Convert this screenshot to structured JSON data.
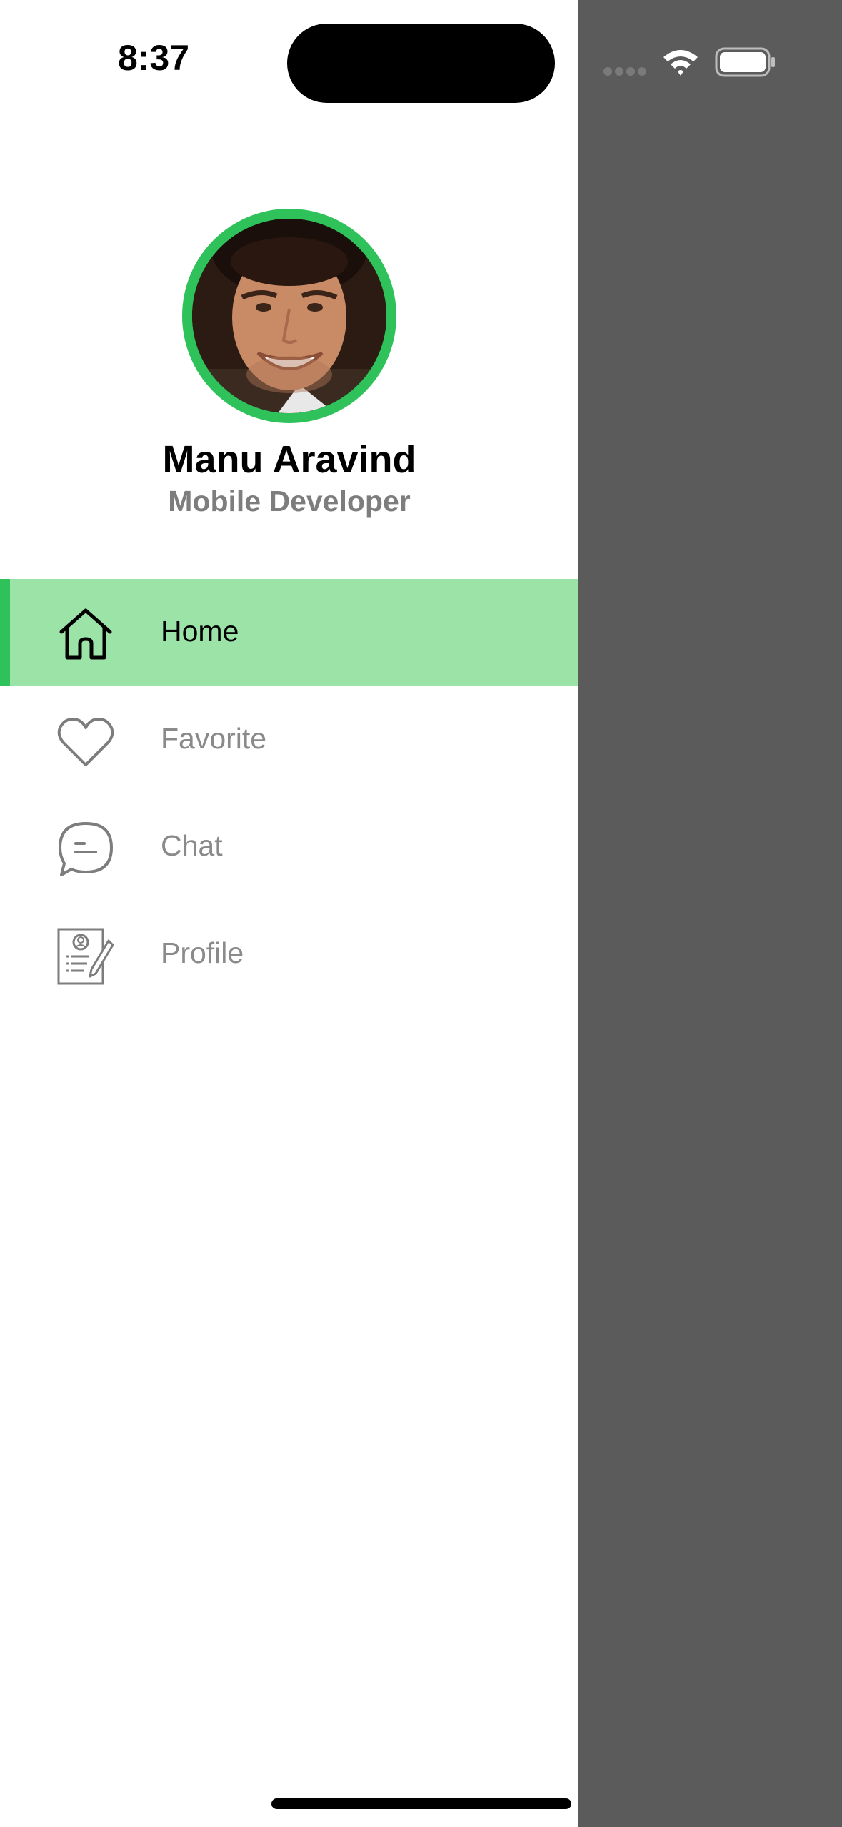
{
  "status_bar": {
    "time": "8:37"
  },
  "profile": {
    "name": "Manu Aravind",
    "role": "Mobile Developer",
    "ring_color": "#2fc25b"
  },
  "menu": {
    "items": [
      {
        "label": "Home",
        "icon": "home-icon",
        "active": true
      },
      {
        "label": "Favorite",
        "icon": "heart-icon",
        "active": false
      },
      {
        "label": "Chat",
        "icon": "chat-icon",
        "active": false
      },
      {
        "label": "Profile",
        "icon": "profile-card-icon",
        "active": false
      }
    ]
  },
  "colors": {
    "accent": "#2fc25b",
    "active_background": "#9ce3a8",
    "overlay": "#5b5b5b",
    "inactive_text": "#8a8a8a"
  }
}
